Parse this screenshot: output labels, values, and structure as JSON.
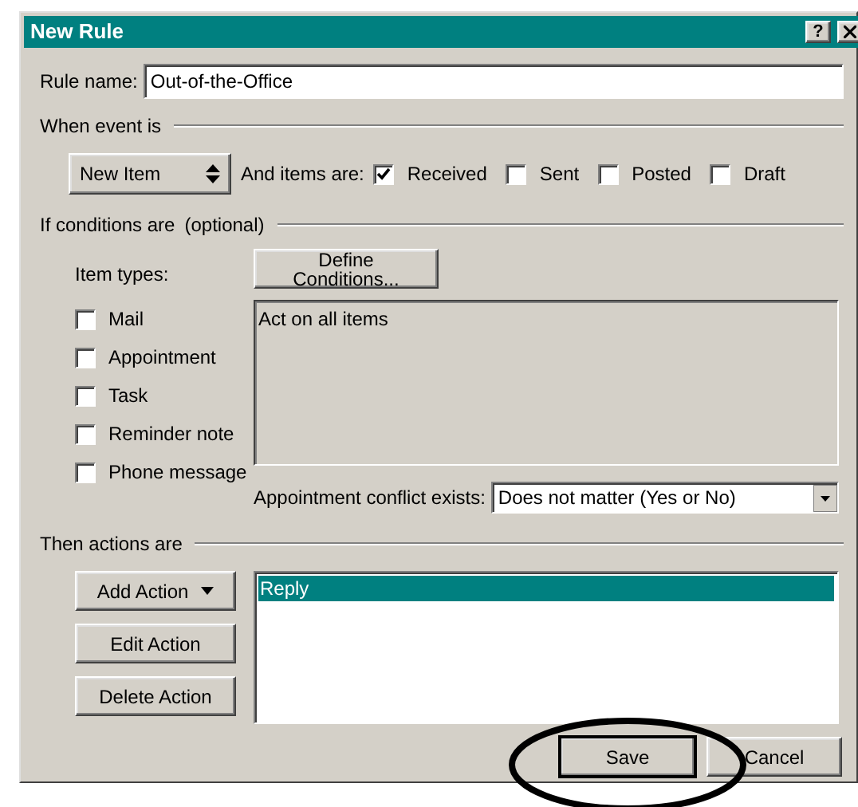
{
  "window": {
    "title": "New Rule",
    "help_button": "?"
  },
  "rule_name": {
    "label": "Rule name:",
    "value": "Out-of-the-Office"
  },
  "event_section": {
    "heading": "When event is",
    "event_type": "New Item",
    "items_label": "And items are:",
    "item_states": [
      {
        "label": "Received",
        "checked": true
      },
      {
        "label": "Sent",
        "checked": false
      },
      {
        "label": "Posted",
        "checked": false
      },
      {
        "label": "Draft",
        "checked": false
      }
    ]
  },
  "conditions_section": {
    "heading": "If conditions are",
    "note": "(optional)",
    "item_types_label": "Item types:",
    "item_types": [
      {
        "label": "Mail",
        "checked": false
      },
      {
        "label": "Appointment",
        "checked": false
      },
      {
        "label": "Task",
        "checked": false
      },
      {
        "label": "Reminder note",
        "checked": false
      },
      {
        "label": "Phone message",
        "checked": false
      }
    ],
    "define_button": "Define Conditions...",
    "conditions_text": "Act on all items",
    "conflict_label": "Appointment conflict exists:",
    "conflict_value": "Does not matter (Yes or No)"
  },
  "actions_section": {
    "heading": "Then actions are",
    "buttons": [
      {
        "label": "Add Action",
        "kind": "dropdown"
      },
      {
        "label": "Edit Action",
        "kind": "plain"
      },
      {
        "label": "Delete Action",
        "kind": "plain"
      }
    ],
    "actions": [
      {
        "label": "Reply",
        "selected": true
      }
    ]
  },
  "footer_buttons": [
    {
      "label": "Save",
      "circled": true
    },
    {
      "label": "Cancel",
      "circled": false
    }
  ]
}
